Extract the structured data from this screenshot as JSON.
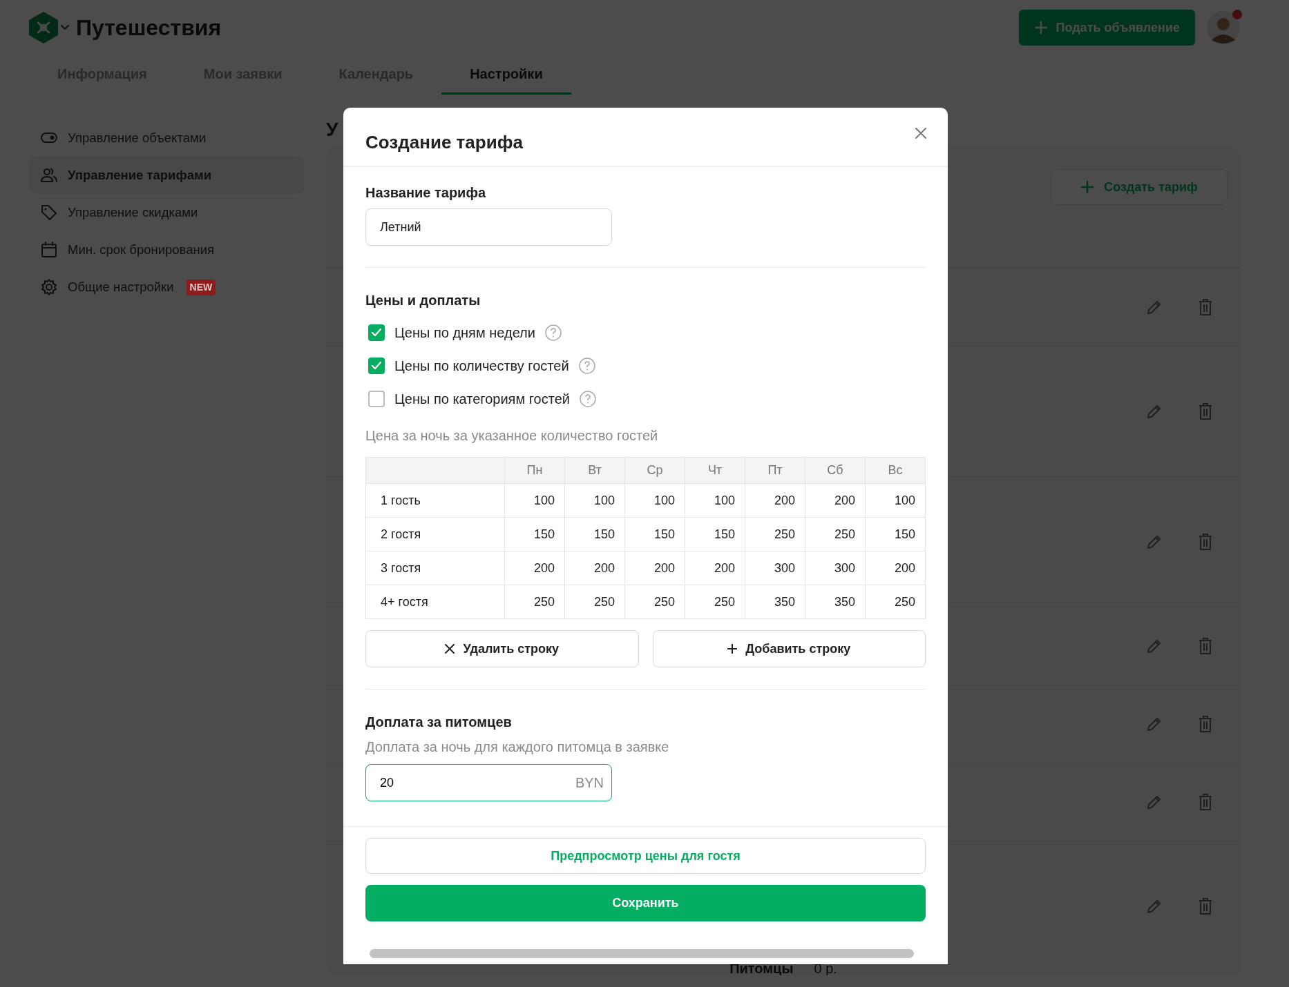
{
  "header": {
    "title": "Путешествия",
    "post_button": "Подать объявление",
    "avatar_notification": true
  },
  "tabs": [
    {
      "label": "Информация",
      "selected": false
    },
    {
      "label": "Мои заявки",
      "selected": false
    },
    {
      "label": "Календарь",
      "selected": false
    },
    {
      "label": "Настройки",
      "selected": true
    }
  ],
  "sidebar": {
    "items": [
      {
        "kind": "toggle",
        "label": "Управление объектами",
        "selected": false
      },
      {
        "kind": "users",
        "label": "Управление тарифами",
        "selected": true
      },
      {
        "kind": "tag",
        "label": "Управление скидками",
        "selected": false
      },
      {
        "kind": "calendar",
        "label": "Мин. срок бронирования",
        "selected": false
      },
      {
        "kind": "gear",
        "label": "Общие настройки",
        "selected": false,
        "badge": "NEW"
      }
    ]
  },
  "main": {
    "heading": "У",
    "create_button": "Создать тариф",
    "rows": [
      {
        "kind": "short"
      },
      {
        "kind": "tall"
      },
      {
        "kind": "tall"
      },
      {
        "kind": "short"
      },
      {
        "kind": "short"
      },
      {
        "kind": "short"
      },
      {
        "kind": "tall"
      }
    ],
    "footer_label": "Питомцы",
    "footer_value": "0 р."
  },
  "modal": {
    "title": "Создание тарифа",
    "name_label": "Название тарифа",
    "name_value": "Летний",
    "prices_heading": "Цены и доплаты",
    "options": [
      {
        "label": "Цены по дням недели",
        "checked": true
      },
      {
        "label": "Цены по количеству гостей",
        "checked": true
      },
      {
        "label": "Цены по категориям гостей",
        "checked": false
      }
    ],
    "table_hint": "Цена за ночь за указанное количество гостей",
    "table": {
      "columns": [
        "Пн",
        "Вт",
        "Ср",
        "Чт",
        "Пт",
        "Сб",
        "Вс"
      ],
      "rows": [
        {
          "label": "1 гость",
          "cells": [
            "100",
            "100",
            "100",
            "100",
            "200",
            "200",
            "100"
          ]
        },
        {
          "label": "2 гостя",
          "cells": [
            "150",
            "150",
            "150",
            "150",
            "250",
            "250",
            "150"
          ]
        },
        {
          "label": "3 гостя",
          "cells": [
            "200",
            "200",
            "200",
            "200",
            "300",
            "300",
            "200"
          ]
        },
        {
          "label": "4+ гостя",
          "cells": [
            "250",
            "250",
            "250",
            "250",
            "350",
            "350",
            "250"
          ]
        }
      ]
    },
    "delete_row_button": "Удалить строку",
    "add_row_button": "Добавить строку",
    "pets_heading": "Доплата за питомцев",
    "pets_hint": "Доплата за ночь для каждого питомца в заявке",
    "pets_value": "20",
    "pets_currency": "BYN",
    "pets_focused": true,
    "preview_button": "Предпросмотр цены для гостя",
    "save_button": "Сохранить"
  }
}
